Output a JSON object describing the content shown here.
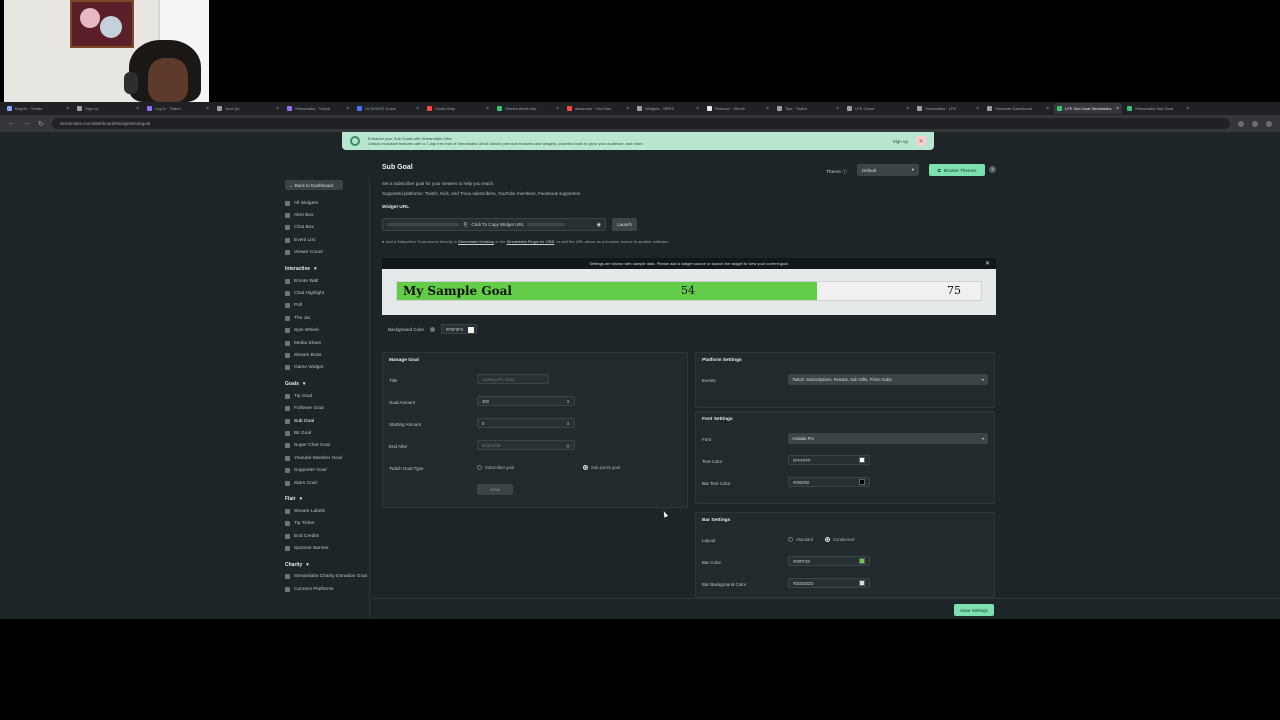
{
  "tabs": [
    {
      "label": "Bug fix · Twitter",
      "color": "#8aa4ff"
    },
    {
      "label": "Sign up",
      "color": "#9aa0a6"
    },
    {
      "label": "Log in · Twitch",
      "color": "#9b6bff"
    },
    {
      "label": "Your Qu",
      "color": "#9aa0a6"
    },
    {
      "label": "Streamlabs · Twitch",
      "color": "#9b6bff"
    },
    {
      "label": "ULTIMATE Guide",
      "color": "#4f6fff"
    },
    {
      "label": "Goals Help",
      "color": "#ff4444"
    },
    {
      "label": "Stream Alerts Bar",
      "color": "#38c172"
    },
    {
      "label": "awesome · YouTube",
      "color": "#ff4444"
    },
    {
      "label": "Widgets · SRRS",
      "color": "#9aa0a6"
    },
    {
      "label": "Release · Github",
      "color": "#e8eaed"
    },
    {
      "label": "Tips · Twitch",
      "color": "#9aa0a6"
    },
    {
      "label": "LFE Game",
      "color": "#9aa0a6"
    },
    {
      "label": "Streamlabs · LFE",
      "color": "#9aa0a6"
    },
    {
      "label": "Streamer Dashboard",
      "color": "#9aa0a6"
    },
    {
      "label": "LFE Sub Goal Streamlabs",
      "color": "#38c172",
      "active": true
    },
    {
      "label": "Streamlabs Sub Goal",
      "color": "#38c172"
    }
  ],
  "browser": {
    "url": "streamlabs.com/dashboard#/widgets/subgoal"
  },
  "promo": {
    "line1": "Enhance your Sub Goals with Streamlabs Ultra",
    "line2": "Unlock exclusive features with a 7-day free trial of Streamlabs Ultra! Unlock premium features and widgets, powerful tools to grow your audience, and more.",
    "signup": "Sign up"
  },
  "sidebar": {
    "back": "Back to Dashboard",
    "top_items": [
      "All Widgets",
      "Alert Box",
      "Chat Box",
      "Event List",
      "Viewer Count"
    ],
    "interactive_head": "Interactive",
    "interactive_items": [
      "Emote Wall",
      "Chat Highlight",
      "Poll",
      "The Jar",
      "Spin Wheel",
      "Media Share",
      "Stream Boss",
      "Game Widget"
    ],
    "goals_head": "Goals",
    "goals_items": [
      "Tip Goal",
      "Follower Goal",
      "Sub Goal",
      "Bit Goal",
      "Super Chat Goal",
      "Youtube Member Goal",
      "Supporter Goal",
      "Stars Goal"
    ],
    "flair_head": "Flair",
    "flair_items": [
      "Stream Labels",
      "Tip Ticker",
      "End Credits",
      "Sponsor Banner"
    ],
    "charity_head": "Charity",
    "charity_items": [
      "Streamlabs Charity Donation Goal",
      "Connect Platforms"
    ]
  },
  "header": {
    "title": "Sub Goal",
    "desc1": "Set a subscriber goal for your viewers to help you reach.",
    "desc2": "Supported platforms: Twitch, Kick, and Trovo subscribers, YouTube members, Facebook supporters",
    "theme_label": "Theme",
    "theme_value": "Default",
    "browse_label": "Browse Themes"
  },
  "widget_url": {
    "label": "Widget URL",
    "copy_text": "Click To Copy Widget URL",
    "launch": "Launch",
    "note_prefix": "Add a Subscriber Goal source directly in ",
    "note_link1": "Streamlabs Desktop",
    "note_mid": " or the ",
    "note_link2": "Streamlabs Plugin for OBS",
    "note_suffix": ", or add the URL above as a browser source to another software."
  },
  "preview": {
    "banner": "Settings are shown with sample data. Please add a widget source or launch the widget to view your current goal.",
    "goal_title": "My Sample Goal",
    "current": "54",
    "goal": "75",
    "progress_fraction": 0.72,
    "bar_color": "#63cc49"
  },
  "background": {
    "label": "Background Color",
    "value": "#F0F0F0"
  },
  "manage_goal": {
    "title": "Manage Goal",
    "fields": {
      "title_label": "Title",
      "title_placeholder": "Gaming PC Goal",
      "amount_label": "Goal Amount",
      "amount_value": "300",
      "start_label": "Starting Amount",
      "start_value": "0",
      "end_label": "End After",
      "end_placeholder": "8/26/2025",
      "type_label": "Twitch Goal Type",
      "type_option1": "Subscriber goal",
      "type_option2": "Sub points goal"
    },
    "save": "Save"
  },
  "platform_settings": {
    "title": "Platform Settings",
    "events_label": "Events",
    "events_value": "Twitch: Subscriptions, Resubs, Sub Gifts, Prime Subs;"
  },
  "font_settings": {
    "title": "Font Settings",
    "font_label": "Font",
    "font_value": "Andada Pro",
    "text_color_label": "Text Color",
    "text_color_value": "#FFFFFF",
    "text_color_hex": "#ffffff",
    "bar_text_label": "Bar Text Color",
    "bar_text_value": "#000000",
    "bar_text_hex": "#000000"
  },
  "bar_settings": {
    "title": "Bar Settings",
    "layout_label": "Layout",
    "layout_opt1": "Standard",
    "layout_opt2": "Condensed",
    "bar_color_label": "Bar Color",
    "bar_color_value": "#00FF29",
    "bar_color_hex": "#63cc49",
    "bar_bg_label": "Bar Background Color",
    "bar_bg_value": "#DDDDDD",
    "bar_bg_hex": "#dddddd"
  },
  "footer": {
    "save_settings": "Save Settings"
  }
}
